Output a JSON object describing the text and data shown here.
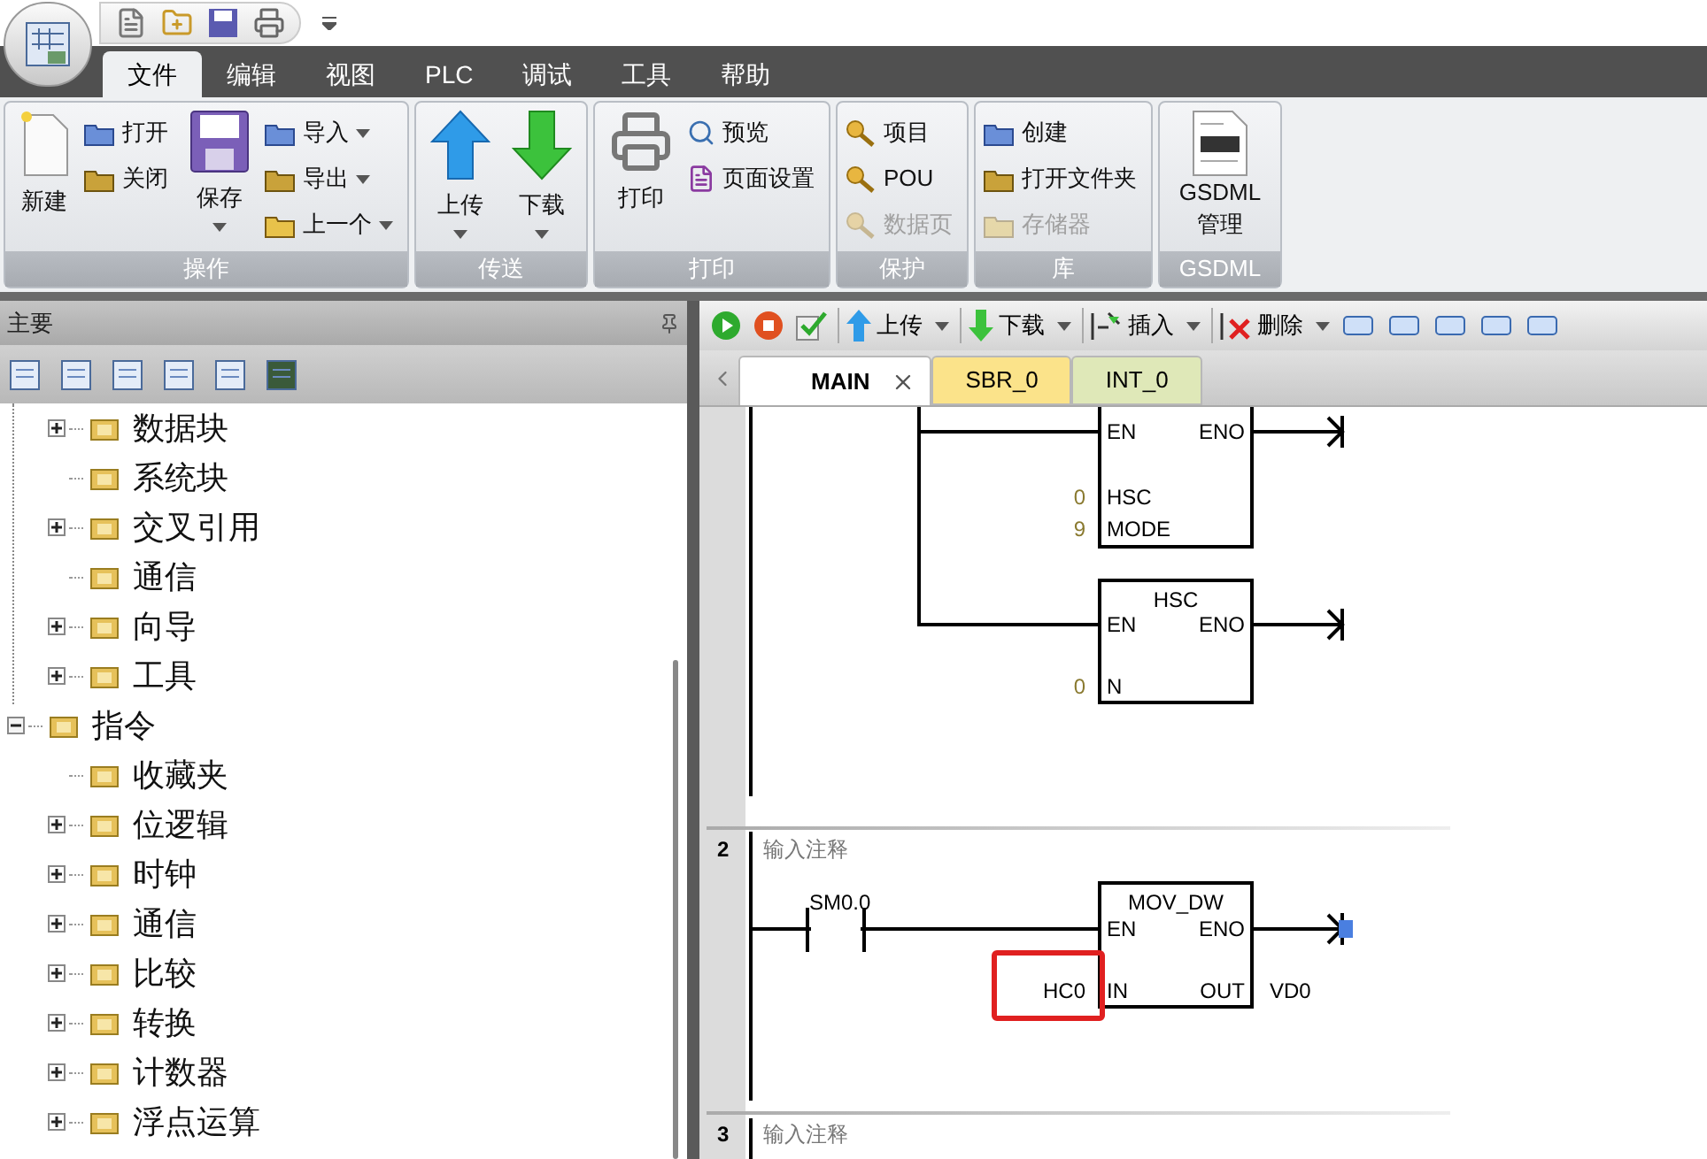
{
  "menu_tabs": [
    {
      "label": "文件",
      "selected": true
    },
    {
      "label": "编辑",
      "selected": false
    },
    {
      "label": "视图",
      "selected": false
    },
    {
      "label": "PLC",
      "selected": false
    },
    {
      "label": "调试",
      "selected": false
    },
    {
      "label": "工具",
      "selected": false
    },
    {
      "label": "帮助",
      "selected": false
    }
  ],
  "ribbon": [
    {
      "title": "操作",
      "items": [
        {
          "label": "新建",
          "kind": "large",
          "dropdown": false,
          "disabled": false
        },
        {
          "label": "打开",
          "kind": "small",
          "dropdown": false,
          "disabled": false
        },
        {
          "label": "关闭",
          "kind": "small",
          "dropdown": false,
          "disabled": false
        },
        {
          "label": "保存",
          "kind": "large",
          "dropdown": true,
          "disabled": false
        },
        {
          "label": "导入",
          "kind": "small",
          "dropdown": true,
          "disabled": false
        },
        {
          "label": "导出",
          "kind": "small",
          "dropdown": true,
          "disabled": false
        },
        {
          "label": "上一个",
          "kind": "small",
          "dropdown": true,
          "disabled": false
        }
      ]
    },
    {
      "title": "传送",
      "items": [
        {
          "label": "上传",
          "kind": "large",
          "dropdown": true,
          "disabled": false
        },
        {
          "label": "下载",
          "kind": "large",
          "dropdown": true,
          "disabled": false
        }
      ]
    },
    {
      "title": "打印",
      "items": [
        {
          "label": "打印",
          "kind": "large",
          "dropdown": false,
          "disabled": false
        },
        {
          "label": "预览",
          "kind": "small",
          "dropdown": false,
          "disabled": false
        },
        {
          "label": "页面设置",
          "kind": "small",
          "dropdown": false,
          "disabled": false
        }
      ]
    },
    {
      "title": "保护",
      "items": [
        {
          "label": "项目",
          "kind": "small",
          "dropdown": false,
          "disabled": false
        },
        {
          "label": "POU",
          "kind": "small",
          "dropdown": false,
          "disabled": false
        },
        {
          "label": "数据页",
          "kind": "small",
          "dropdown": false,
          "disabled": true
        }
      ]
    },
    {
      "title": "库",
      "items": [
        {
          "label": "创建",
          "kind": "small",
          "dropdown": false,
          "disabled": false
        },
        {
          "label": "打开文件夹",
          "kind": "small",
          "dropdown": false,
          "disabled": false
        },
        {
          "label": "存储器",
          "kind": "small",
          "dropdown": false,
          "disabled": true
        }
      ]
    },
    {
      "title": "GSDML",
      "items": [
        {
          "label": "GSDML管理",
          "kind": "large",
          "dropdown": false,
          "disabled": false
        }
      ]
    }
  ],
  "panel": {
    "title": "主要",
    "tree": [
      {
        "expanded": true,
        "children": [
          {
            "label": "数据块",
            "expandable": true,
            "expanded": false
          },
          {
            "label": "系统块",
            "expandable": false
          },
          {
            "label": "交叉引用",
            "expandable": true,
            "expanded": false
          },
          {
            "label": "通信",
            "expandable": false
          },
          {
            "label": "向导",
            "expandable": true,
            "expanded": false
          },
          {
            "label": "工具",
            "expandable": true,
            "expanded": false
          }
        ]
      },
      {
        "label": "指令",
        "expandable": true,
        "expanded": true,
        "children": [
          {
            "label": "收藏夹",
            "expandable": false
          },
          {
            "label": "位逻辑",
            "expandable": true,
            "expanded": false
          },
          {
            "label": "时钟",
            "expandable": true,
            "expanded": false
          },
          {
            "label": "通信",
            "expandable": true,
            "expanded": false
          },
          {
            "label": "比较",
            "expandable": true,
            "expanded": false
          },
          {
            "label": "转换",
            "expandable": true,
            "expanded": false
          },
          {
            "label": "计数器",
            "expandable": true,
            "expanded": false
          },
          {
            "label": "浮点运算",
            "expandable": true,
            "expanded": false
          }
        ]
      }
    ]
  },
  "editor_toolbar": [
    {
      "label": "上传",
      "kind": "upload"
    },
    {
      "label": "下载",
      "kind": "download"
    },
    {
      "label": "插入",
      "kind": "insert"
    },
    {
      "label": "删除",
      "kind": "delete"
    }
  ],
  "tabs": [
    {
      "label": "MAIN",
      "selected": true,
      "closable": true,
      "color": "#ffffff"
    },
    {
      "label": "SBR_0",
      "selected": false,
      "closable": false,
      "color": "#fbe38a"
    },
    {
      "label": "INT_0",
      "selected": false,
      "closable": false,
      "color": "#dfe8b8"
    }
  ],
  "networks": [
    {
      "boxes": [
        {
          "inputs": [
            {
              "name": "EN"
            },
            {
              "name": "HSC",
              "value": "0"
            },
            {
              "name": "MODE",
              "value": "9"
            }
          ],
          "outputs": [
            {
              "name": "ENO"
            }
          ],
          "end_selected": false
        },
        {
          "title": "HSC",
          "inputs": [
            {
              "name": "EN"
            },
            {
              "name": "N",
              "value": "0"
            }
          ],
          "outputs": [
            {
              "name": "ENO"
            }
          ],
          "end_selected": false
        }
      ]
    },
    {
      "number": "2",
      "comment": "输入注释",
      "contact": {
        "label": "SM0.0"
      },
      "boxes": [
        {
          "title": "MOV_DW",
          "inputs": [
            {
              "name": "EN"
            },
            {
              "name": "IN",
              "value": "HC0",
              "highlighted": true
            }
          ],
          "outputs": [
            {
              "name": "ENO"
            },
            {
              "name": "OUT",
              "value": "VD0"
            }
          ],
          "end_selected": true
        }
      ]
    },
    {
      "number": "3",
      "comment": "输入注释"
    }
  ]
}
